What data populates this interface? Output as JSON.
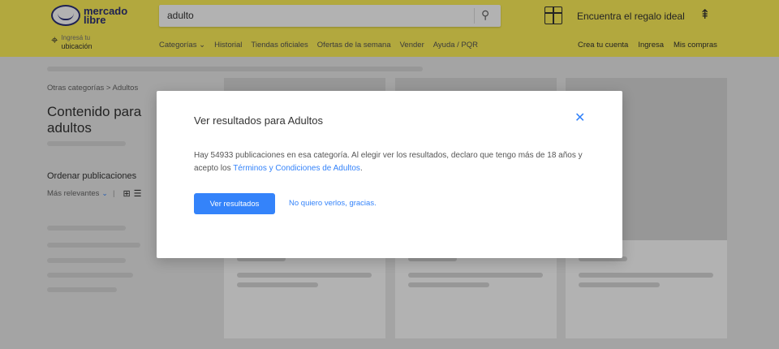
{
  "header": {
    "logo_text_line1": "mercado",
    "logo_text_line2": "libre",
    "location_top": "Ingresá tu",
    "location_bottom": "ubicación",
    "search_value": "adulto",
    "gift_label": "Encuentra el regalo ideal",
    "nav": [
      "Categorías ⌄",
      "Historial",
      "Tiendas oficiales",
      "Ofertas de la semana",
      "Vender",
      "Ayuda / PQR"
    ],
    "user_nav": [
      "Crea tu cuenta",
      "Ingresa",
      "Mis compras"
    ]
  },
  "page": {
    "breadcrumb": "Otras categorías > Adultos",
    "title": "Contenido para adultos",
    "sort_title": "Ordenar publicaciones",
    "sort_value": "Más relevantes"
  },
  "modal": {
    "title": "Ver resultados para Adultos",
    "body_text": "Hay 54933 publicaciones en esa categoría. Al elegir ver los resultados, declaro que tengo más de 18 años y acepto los ",
    "body_link": "Términos y Condiciones de Adultos",
    "body_end": ".",
    "primary_button": "Ver resultados",
    "secondary_link": "No quiero verlos, gracias."
  },
  "colors": {
    "header_bg": "#fff159",
    "accent": "#3483fa"
  },
  "icons": {
    "search": "search-icon",
    "location": "location-pin-icon",
    "gift": "gift-icon",
    "tree": "tree-icon",
    "close": "close-icon"
  }
}
